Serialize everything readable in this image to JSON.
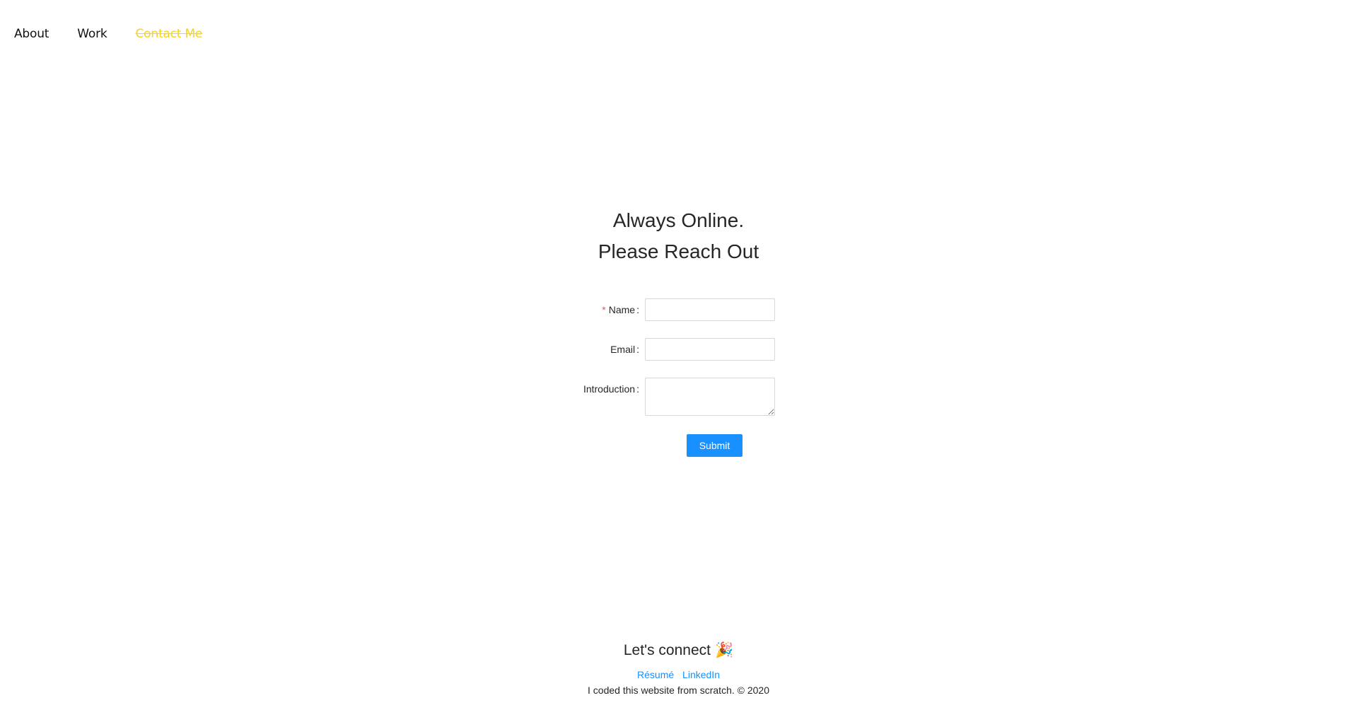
{
  "nav": {
    "items": [
      {
        "label": "About",
        "active": false
      },
      {
        "label": "Work",
        "active": false
      },
      {
        "label": "Contact Me",
        "active": true
      }
    ],
    "active_color": "#f7d31a"
  },
  "hero": {
    "line1": "Always Online.",
    "line2": "Please Reach Out"
  },
  "form": {
    "fields": [
      {
        "label": "Name",
        "required": true,
        "value": "",
        "type": "input"
      },
      {
        "label": "Email",
        "required": false,
        "value": "",
        "type": "input"
      },
      {
        "label": "Introduction",
        "required": false,
        "value": "",
        "type": "textarea"
      }
    ],
    "submit_label": "Submit",
    "submit_color": "#1890ff"
  },
  "footer": {
    "title": "Let's connect",
    "icon": "party-popper-icon",
    "links": [
      {
        "label": "Résumé"
      },
      {
        "label": "LinkedIn"
      }
    ],
    "credit": "I coded this website from scratch. © 2020"
  }
}
